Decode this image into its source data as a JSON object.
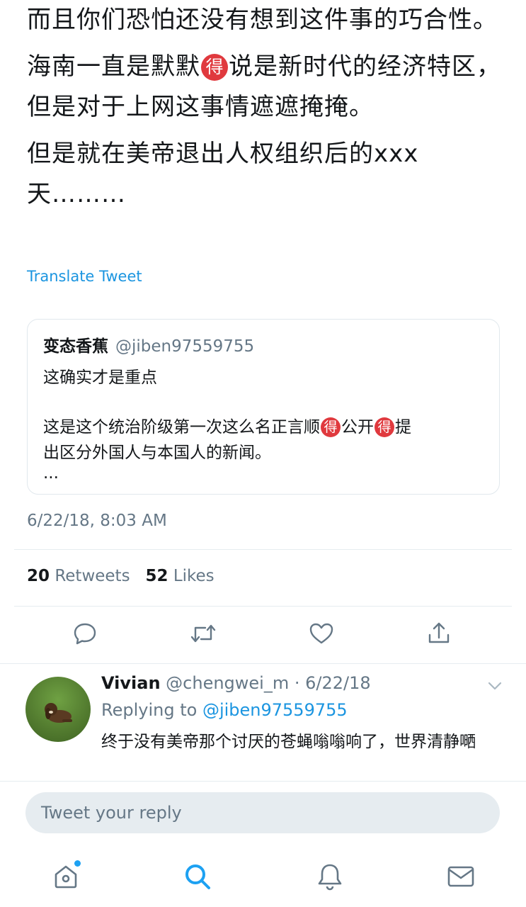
{
  "tweet": {
    "paragraphs": [
      {
        "pre": "而且你们恐怕还没有想到这件事的巧合性。",
        "emoji": "",
        "post": ""
      },
      {
        "pre": "海南一直是默默",
        "emoji": "得",
        "post": "说是新时代的经济特区，但是对于上网这事情遮遮掩掩。"
      },
      {
        "pre": "但是就在美帝退出人权组织后的xxx天………",
        "emoji": "",
        "post": ""
      }
    ],
    "translate_label": "Translate Tweet",
    "timestamp": "6/22/18, 8:03 AM",
    "retweets_count": "20",
    "retweets_label": "Retweets",
    "likes_count": "52",
    "likes_label": "Likes"
  },
  "quoted": {
    "name": "变态香蕉",
    "handle": "@jiben97559755",
    "line1": "这确实才是重点",
    "line2_a": "这是这个统治阶级第一次这么名正言顺",
    "line2_emoji1": "得",
    "line2_b": "公开",
    "line2_emoji2": "得",
    "line2_c": "提",
    "line3": "出区分外国人与本国人的新闻。",
    "line4": "..."
  },
  "actions": {
    "icons": [
      "reply-icon",
      "retweet-icon",
      "like-icon",
      "share-icon"
    ]
  },
  "reply": {
    "name": "Vivian",
    "meta": "@chengwei_m · 6/22/18",
    "replying_prefix": "Replying to",
    "replying_to": "@jiben97559755",
    "text": "终于没有美帝那个讨厌的苍蝇嗡嗡响了，世界清静嗮"
  },
  "composer": {
    "placeholder": "Tweet your reply"
  },
  "tabbar": {
    "icons": [
      "home-icon",
      "search-icon",
      "notifications-icon",
      "messages-icon"
    ],
    "active": "search-icon",
    "accent": "#1da1f2"
  },
  "colors": {
    "link": "#1b95e0",
    "muted": "#657786",
    "emoji_badge": "#e0393e"
  }
}
